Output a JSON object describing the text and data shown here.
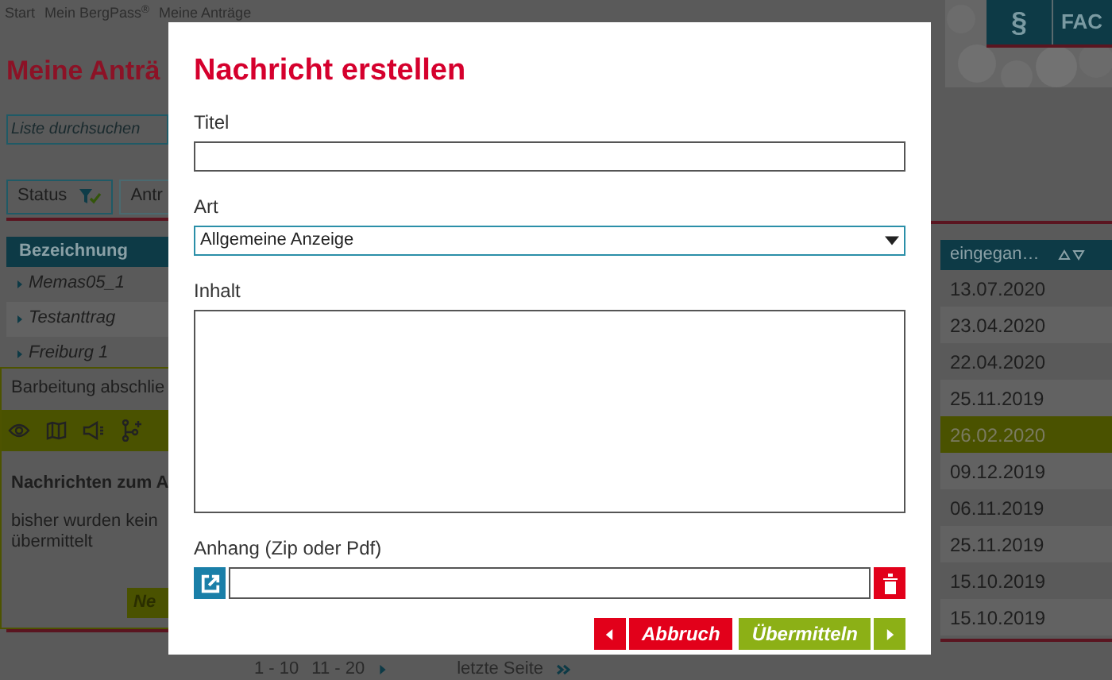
{
  "breadcrumb": [
    {
      "label": "Start"
    },
    {
      "label": "Mein BergPass$^{®}$"
    },
    {
      "label": "Meine Anträge"
    }
  ],
  "header_buttons": [
    {
      "label": "§"
    },
    {
      "label": "FAC"
    }
  ],
  "page_title": "Meine Anträ",
  "search": {
    "placeholder": "Liste durchsuchen"
  },
  "filters": [
    {
      "label": "Status",
      "filtered": true
    },
    {
      "label": "Antr",
      "filtered": false
    }
  ],
  "table": {
    "columns": [
      "Bezeichnung",
      "eingegan…"
    ],
    "name_rows": [
      {
        "name": "Memas05_1",
        "selected": false
      },
      {
        "name": "Testanttrag",
        "selected": false
      },
      {
        "name": "Freiburg 1",
        "selected": false
      }
    ],
    "date_rows": [
      {
        "date": "13.07.2020",
        "selected": false
      },
      {
        "date": "23.04.2020",
        "selected": false
      },
      {
        "date": "22.04.2020",
        "selected": false
      },
      {
        "date": "25.11.2019",
        "selected": false
      },
      {
        "date": "26.02.2020",
        "selected": true
      },
      {
        "date": "09.12.2019",
        "selected": false
      },
      {
        "date": "06.11.2019",
        "selected": false
      },
      {
        "date": "25.11.2019",
        "selected": false
      },
      {
        "date": "15.10.2019",
        "selected": false
      },
      {
        "date": "15.10.2019",
        "selected": false
      }
    ]
  },
  "detail_panel": {
    "action": "Barbeitung abschlie",
    "heading": "Nachrichten zum A",
    "text": "bisher wurden kein\nübermittelt",
    "button": "Ne"
  },
  "pagination": [
    {
      "label": "1 - 10"
    },
    {
      "label": "11 - 20"
    },
    {
      "label": "letzte Seite"
    }
  ],
  "dialog": {
    "title": "Nachricht erstellen",
    "fields": [
      {
        "kind": "text",
        "label": "Titel"
      },
      {
        "kind": "select",
        "label": "Art",
        "value": "Allgemeine Anzeige"
      },
      {
        "kind": "textarea",
        "label": "Inhalt"
      },
      {
        "kind": "file",
        "label": "Anhang (Zip oder Pdf)"
      }
    ],
    "buttons": [
      {
        "kind": "cancel",
        "label": "Abbruch"
      },
      {
        "kind": "submit",
        "label": "Übermitteln"
      }
    ]
  }
}
